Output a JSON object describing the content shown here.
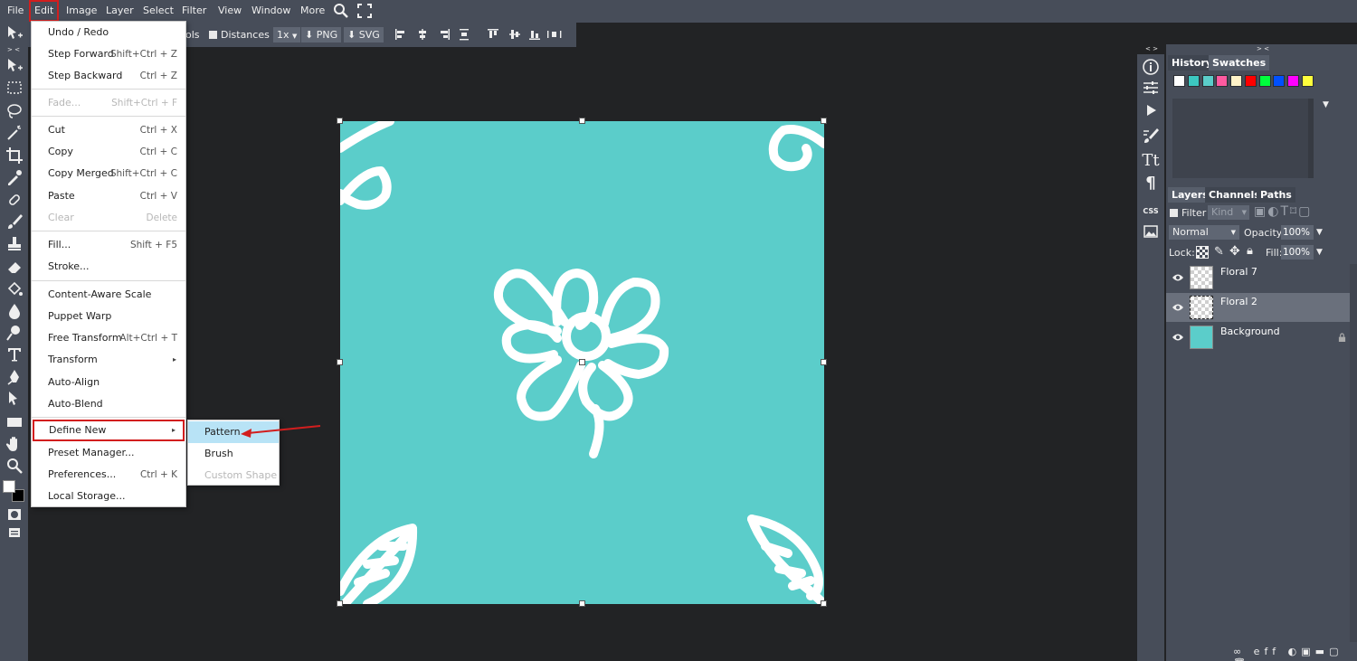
{
  "menubar": {
    "items": [
      "File",
      "Edit",
      "Image",
      "Layer",
      "Select",
      "Filter",
      "View",
      "Window",
      "More"
    ],
    "active": "Edit"
  },
  "optionsbar": {
    "partial_label": "ols",
    "distances_label": "Distances",
    "zoom_value": "1x",
    "png_label": "PNG",
    "svg_label": "SVG"
  },
  "edit_menu": {
    "items": [
      {
        "label": "Undo / Redo",
        "shortcut": ""
      },
      {
        "label": "Step Forward",
        "shortcut": "Shift+Ctrl + Z"
      },
      {
        "label": "Step Backward",
        "shortcut": "Ctrl + Z"
      },
      {
        "label": "Fade...",
        "shortcut": "Shift+Ctrl + F"
      },
      {
        "label": "Cut",
        "shortcut": "Ctrl + X"
      },
      {
        "label": "Copy",
        "shortcut": "Ctrl + C"
      },
      {
        "label": "Copy Merged",
        "shortcut": "Shift+Ctrl + C"
      },
      {
        "label": "Paste",
        "shortcut": "Ctrl + V"
      },
      {
        "label": "Clear",
        "shortcut": "Delete"
      },
      {
        "label": "Fill...",
        "shortcut": "Shift + F5"
      },
      {
        "label": "Stroke...",
        "shortcut": ""
      },
      {
        "label": "Content-Aware Scale",
        "shortcut": ""
      },
      {
        "label": "Puppet Warp",
        "shortcut": ""
      },
      {
        "label": "Free Transform",
        "shortcut": "Alt+Ctrl + T"
      },
      {
        "label": "Transform",
        "shortcut": ""
      },
      {
        "label": "Auto-Align",
        "shortcut": ""
      },
      {
        "label": "Auto-Blend",
        "shortcut": ""
      },
      {
        "label": "Define New",
        "shortcut": ""
      },
      {
        "label": "Preset Manager...",
        "shortcut": ""
      },
      {
        "label": "Preferences...",
        "shortcut": "Ctrl + K"
      },
      {
        "label": "Local Storage...",
        "shortcut": ""
      }
    ]
  },
  "define_new_submenu": {
    "items": [
      {
        "label": "Pattern"
      },
      {
        "label": "Brush"
      },
      {
        "label": "Custom Shape"
      }
    ]
  },
  "right_panel": {
    "top_tabs": [
      "History",
      "Swatches"
    ],
    "swatch_colors": [
      "#ffffff",
      "#3cc7c0",
      "#5bcdca",
      "#ff5aa0",
      "#fff3c8",
      "#ff0000",
      "#00ff3c",
      "#0050ff",
      "#ff00ff",
      "#ffff3c"
    ],
    "layer_tabs": [
      "Layers",
      "Channels",
      "Paths"
    ],
    "filter_label": "Filter",
    "kind_value": "Kind",
    "blend_mode": "Normal",
    "opacity_label": "Opacity:",
    "opacity_value": "100%",
    "lock_label": "Lock:",
    "fill_label": "Fill:",
    "fill_value": "100%",
    "layers": [
      {
        "name": "Floral 7"
      },
      {
        "name": "Floral 2"
      },
      {
        "name": "Background"
      }
    ],
    "bottom_icons_text": "eff"
  },
  "right_icons": {
    "css_label": "CSS"
  },
  "colors": {
    "canvas": "#5bcdca",
    "highlight": "#d21e1e",
    "submenu_hover": "#b8e3f6"
  }
}
